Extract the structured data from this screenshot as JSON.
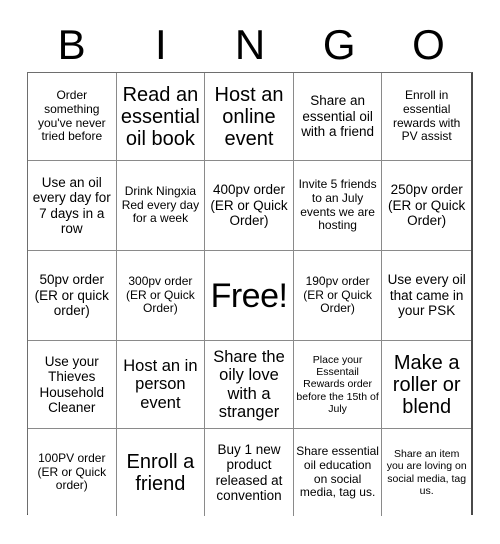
{
  "header": {
    "letters": [
      "B",
      "I",
      "N",
      "G",
      "O"
    ]
  },
  "grid": {
    "rows": 5,
    "columns": 5,
    "cells": [
      {
        "text": "Order something you've never tried before",
        "size": "fs-sm"
      },
      {
        "text": "Read an essential oil book",
        "size": "fs-xl"
      },
      {
        "text": "Host an online event",
        "size": "fs-xl"
      },
      {
        "text": "Share an essential oil with a friend",
        "size": "fs-md"
      },
      {
        "text": "Enroll in essential rewards with PV assist",
        "size": "fs-sm"
      },
      {
        "text": "Use an oil every day for 7 days in a row",
        "size": "fs-md"
      },
      {
        "text": "Drink Ningxia Red every day for a week",
        "size": "fs-sm"
      },
      {
        "text": "400pv order (ER or Quick Order)",
        "size": "fs-md"
      },
      {
        "text": "Invite 5 friends to an July events we are hosting",
        "size": "fs-sm"
      },
      {
        "text": "250pv order (ER or Quick Order)",
        "size": "fs-md"
      },
      {
        "text": "50pv order (ER or quick order)",
        "size": "fs-md"
      },
      {
        "text": "300pv order (ER or Quick Order)",
        "size": "fs-sm"
      },
      {
        "text": "Free!",
        "size": "fs-free"
      },
      {
        "text": "190pv order (ER or Quick Order)",
        "size": "fs-sm"
      },
      {
        "text": "Use every oil that came in your PSK",
        "size": "fs-md"
      },
      {
        "text": "Use your Thieves Household Cleaner",
        "size": "fs-md"
      },
      {
        "text": "Host an in person event",
        "size": "fs-lg"
      },
      {
        "text": "Share the oily love with a stranger",
        "size": "fs-lg"
      },
      {
        "text": "Place your Essentail Rewards order before the 15th of July",
        "size": "fs-xs"
      },
      {
        "text": "Make a roller or blend",
        "size": "fs-xl"
      },
      {
        "text": "100PV order (ER or Quick order)",
        "size": "fs-sm"
      },
      {
        "text": "Enroll a friend",
        "size": "fs-xl"
      },
      {
        "text": "Buy 1 new product released at convention",
        "size": "fs-md"
      },
      {
        "text": "Share essential oil education on social media, tag us.",
        "size": "fs-sm"
      },
      {
        "text": "Share an item you are loving on social media, tag us.",
        "size": "fs-xs"
      }
    ]
  }
}
